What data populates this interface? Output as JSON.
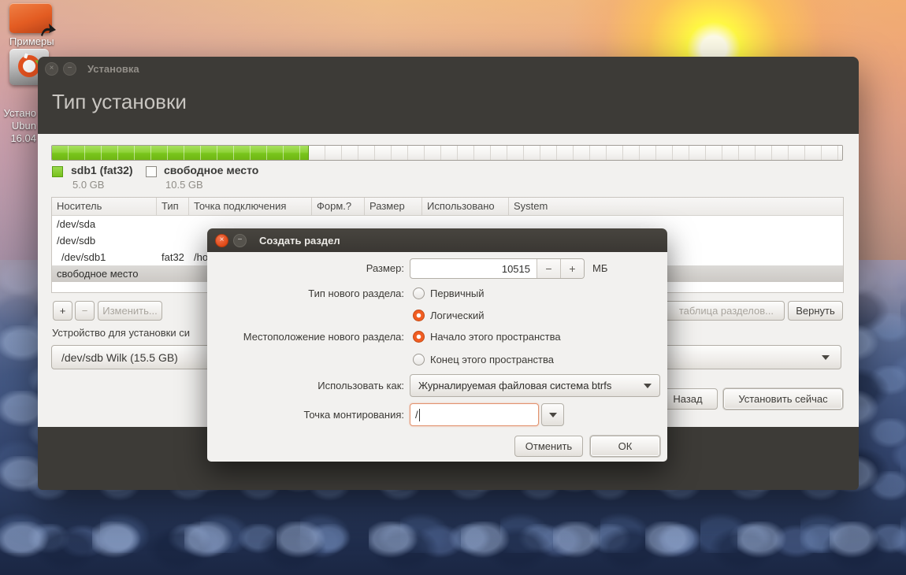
{
  "colors": {
    "accent_orange": "#e95420",
    "partition_green": "#7ac120",
    "window_dark": "#3d3b37",
    "content_light": "#f2f1ef"
  },
  "desktop": {
    "icons": {
      "examples": {
        "label": "Примеры"
      },
      "installer": {
        "label_lines": [
          "Устано",
          "Ubun",
          "16.04"
        ]
      }
    }
  },
  "main_window": {
    "titlebar": {
      "title": "Установка",
      "close_glyph": "×",
      "minimize_glyph": "−"
    },
    "heading": "Тип установки",
    "legend": [
      {
        "label": "sdb1 (fat32)",
        "size": "5.0 GB"
      },
      {
        "label": "свободное место",
        "size": "10.5 GB"
      }
    ],
    "table": {
      "columns": [
        "Носитель",
        "Тип",
        "Точка подключения",
        "Форм.?",
        "Размер",
        "Использовано",
        "System"
      ],
      "rows": [
        {
          "device": "/dev/sda",
          "type": "",
          "mount": ""
        },
        {
          "device": "/dev/sdb",
          "type": "",
          "mount": ""
        },
        {
          "device": "/dev/sdb1",
          "type": "fat32",
          "mount": "/ho"
        },
        {
          "device": "свободное место",
          "type": "",
          "mount": ""
        }
      ]
    },
    "toolbar": {
      "add": "+",
      "remove": "−",
      "change": "Изменить...",
      "partition_table": "таблица разделов...",
      "revert": "Вернуть"
    },
    "boot_device": {
      "label": "Устройство для установки си",
      "value": "/dev/sdb   Wilk   (15.5 GB)"
    },
    "nav": {
      "back": "Назад",
      "install": "Установить сейчас"
    }
  },
  "dialog": {
    "titlebar": {
      "title": "Создать раздел",
      "close_glyph": "×",
      "minimize_glyph": "−"
    },
    "size_row": {
      "label": "Размер:",
      "value": "10515",
      "minus": "−",
      "plus": "+",
      "unit": "МБ"
    },
    "type_row": {
      "label": "Тип нового раздела:",
      "options": [
        {
          "label": "Первичный",
          "selected": false
        },
        {
          "label": "Логический",
          "selected": true
        }
      ]
    },
    "location_row": {
      "label": "Местоположение нового раздела:",
      "options": [
        {
          "label": "Начало этого пространства",
          "selected": true
        },
        {
          "label": "Конец этого пространства",
          "selected": false
        }
      ]
    },
    "use_as_row": {
      "label": "Использовать как:",
      "value": "Журналируемая файловая система btrfs"
    },
    "mount_row": {
      "label": "Точка монтирования:",
      "value": "/"
    },
    "buttons": {
      "cancel": "Отменить",
      "ok": "ОК"
    }
  }
}
